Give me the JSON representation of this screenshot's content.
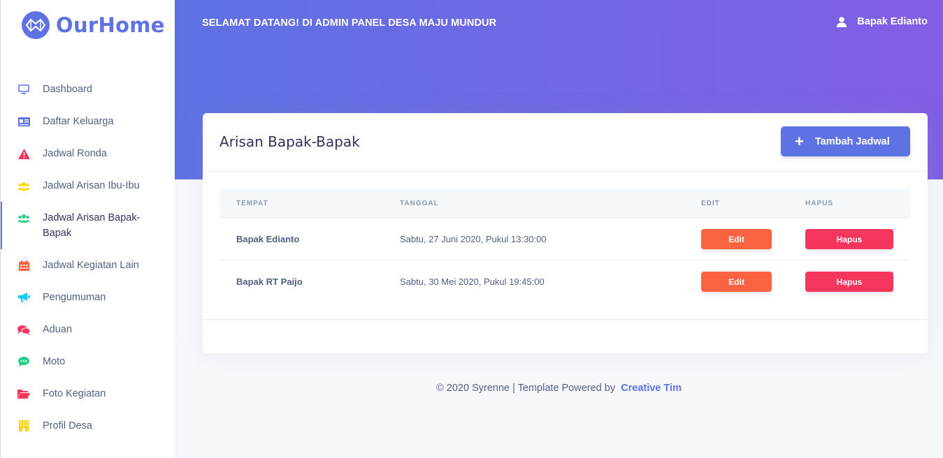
{
  "brand": {
    "name": "OurHome"
  },
  "sidebar": {
    "items": [
      {
        "label": "Dashboard",
        "icon": "monitor-icon",
        "color": "#5e72e4"
      },
      {
        "label": "Daftar Keluarga",
        "icon": "id-card-icon",
        "color": "#5e72e4"
      },
      {
        "label": "Jadwal Ronda",
        "icon": "warning-icon",
        "color": "#f5365c"
      },
      {
        "label": "Jadwal Arisan Ibu-Ibu",
        "icon": "users-icon",
        "color": "#ffd600"
      },
      {
        "label": "Jadwal Arisan Bapak-Bapak",
        "icon": "users-icon",
        "color": "#2dce89",
        "active": true
      },
      {
        "label": "Jadwal Kegiatan Lain",
        "icon": "calendar-icon",
        "color": "#fb6340"
      },
      {
        "label": "Pengumuman",
        "icon": "megaphone-icon",
        "color": "#11cdef"
      },
      {
        "label": "Aduan",
        "icon": "chat-icon",
        "color": "#f5365c"
      },
      {
        "label": "Moto",
        "icon": "comment-icon",
        "color": "#2dce89"
      },
      {
        "label": "Foto Kegiatan",
        "icon": "folder-icon",
        "color": "#f5365c"
      },
      {
        "label": "Profil Desa",
        "icon": "building-icon",
        "color": "#ffd600"
      }
    ]
  },
  "header": {
    "welcome": "SELAMAT DATANG! DI ADMIN PANEL DESA MAJU MUNDUR",
    "user_name": "Bapak Edianto"
  },
  "card": {
    "title": "Arisan Bapak-Bapak",
    "add_button": "Tambah Jadwal",
    "columns": [
      "TEMPAT",
      "TANGGAL",
      "EDIT",
      "HAPUS"
    ],
    "rows": [
      {
        "tempat": "Bapak Edianto",
        "tanggal": "Sabtu, 27 Juni 2020, Pukul 13:30:00",
        "edit": "Edit",
        "hapus": "Hapus"
      },
      {
        "tempat": "Bapak RT Paijo",
        "tanggal": "Sabtu, 30 Mei 2020, Pukul 19:45:00",
        "edit": "Edit",
        "hapus": "Hapus"
      }
    ]
  },
  "footer": {
    "text": "© 2020 Syrenne | Template Powered by",
    "link": "Creative Tim"
  },
  "colors": {
    "primary": "#5e72e4",
    "warning": "#fb6340",
    "danger": "#f5365c"
  }
}
